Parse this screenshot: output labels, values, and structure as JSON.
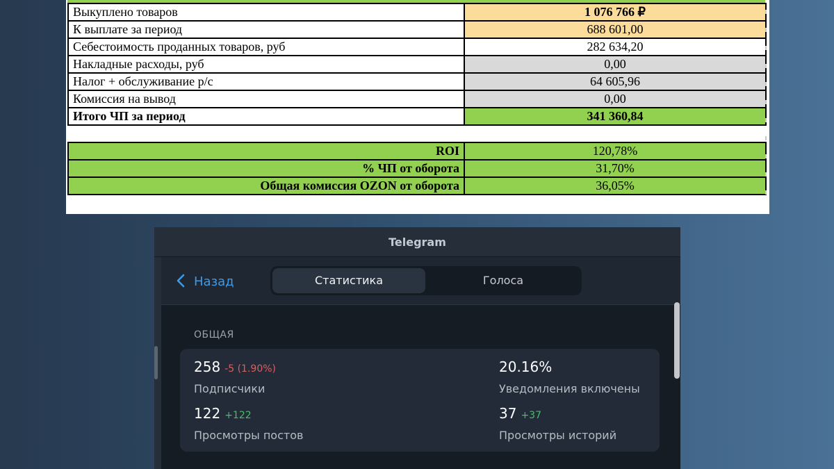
{
  "sheet": {
    "rows": [
      {
        "label": "Выкуплено товаров",
        "value": "1 076 766 ₽"
      },
      {
        "label": "К выплате за период",
        "value": "688 601,00"
      },
      {
        "label": "Себестоимость проданных товаров, руб",
        "value": "282 634,20"
      },
      {
        "label": "Накладные расходы, руб",
        "value": "0,00"
      },
      {
        "label": "Налог + обслуживание р/с",
        "value": "64 605,96"
      },
      {
        "label": "Комиссия на вывод",
        "value": "0,00"
      },
      {
        "label": "Итого ЧП за период",
        "value": "341 360,84"
      }
    ],
    "metrics": [
      {
        "label": "ROI",
        "value": "120,78%"
      },
      {
        "label": "% ЧП от оборота",
        "value": "31,70%"
      },
      {
        "label": "Общая комиссия OZON от оборота",
        "value": "36,05%"
      }
    ],
    "colors": {
      "yellow": "#fbdc9a",
      "gray": "#d9d9d9",
      "green": "#92d050"
    }
  },
  "telegram": {
    "window_title": "Telegram",
    "back_label": "Назад",
    "tabs": [
      {
        "label": "Статистика",
        "active": true
      },
      {
        "label": "Голоса",
        "active": false
      }
    ],
    "section_title": "ОБЩАЯ",
    "stats": [
      {
        "value": "258",
        "delta": "-5 (1.90%)",
        "delta_type": "negative",
        "label": "Подписчики"
      },
      {
        "value": "20.16%",
        "delta": "",
        "label": "Уведомления включены"
      },
      {
        "value": "122",
        "delta": "+122",
        "delta_type": "positive",
        "label": "Просмотры постов"
      },
      {
        "value": "37",
        "delta": "+37",
        "delta_type": "positive",
        "label": "Просмотры историй"
      }
    ],
    "colors": {
      "accent": "#3e9be8",
      "negative": "#e05d5d",
      "positive": "#4cbb6a",
      "background": "#1c2430"
    }
  }
}
